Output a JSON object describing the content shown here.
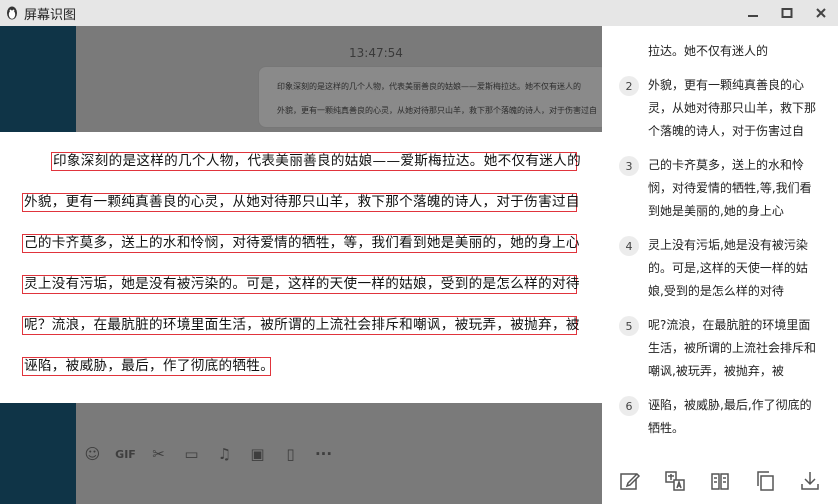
{
  "window": {
    "title": "屏幕识图"
  },
  "background": {
    "time": "13:47:54",
    "bubble_line1": "印象深刻的是这样的几个人物，代表美丽善良的姑娘——爱斯梅拉达。她不仅有迷人的",
    "bubble_line2": "外貌，更有一颗纯真善良的心灵，从她对待那只山羊，救下那个落魄的诗人，对于伤害过自"
  },
  "ocr_lines": [
    "印象深刻的是这样的几个人物，代表美丽善良的姑娘——爱斯梅拉达。她不仅有迷人的",
    "外貌，更有一颗纯真善良的心灵，从她对待那只山羊，救下那个落魄的诗人，对于伤害过自",
    "己的卡齐莫多，送上的水和怜悯，对待爱情的牺牲，等，我们看到她是美丽的，她的身上心",
    "灵上没有污垢，她是没有被污染的。可是，这样的天使一样的姑娘，受到的是怎么样的对待",
    "呢？流浪，在最肮脏的环境里面生活，被所谓的上流社会排斥和嘲讽，被玩弄，被抛弃，被",
    "诬陷，被威胁，最后，作了彻底的牺牲。"
  ],
  "results": {
    "p1_tail": "拉达。她不仅有迷人的",
    "paragraphs": [
      {
        "num": "2",
        "lines": [
          "外貌，更有一颗纯真善良的心",
          "灵，从她对待那只山羊，救下那",
          "个落魄的诗人，对于伤害过自"
        ]
      },
      {
        "num": "3",
        "lines": [
          "己的卡齐莫多，送上的水和怜",
          "悯，对待爱情的牺牲,等,我们看",
          "到她是美丽的,她的身上心"
        ]
      },
      {
        "num": "4",
        "lines": [
          "灵上没有污垢,她是没有被污染",
          "的。可是,这样的天使一样的姑",
          "娘,受到的是怎么样的对待"
        ]
      },
      {
        "num": "5",
        "lines": [
          "呢?流浪，在最肮脏的环境里面",
          "生活，被所谓的上流社会排斥和",
          "嘲讽,被玩弄，被抛弃，被"
        ]
      },
      {
        "num": "6",
        "lines": [
          "诬陷，被威胁,最后,作了彻底的",
          "牺牲。"
        ]
      }
    ]
  },
  "icons": {
    "app": "penguin-icon",
    "minimize": "minimize-icon",
    "maximize": "maximize-icon",
    "close": "close-icon",
    "toolbar": [
      "edit-icon",
      "translate-icon",
      "split-icon",
      "copy-icon",
      "download-icon"
    ]
  }
}
